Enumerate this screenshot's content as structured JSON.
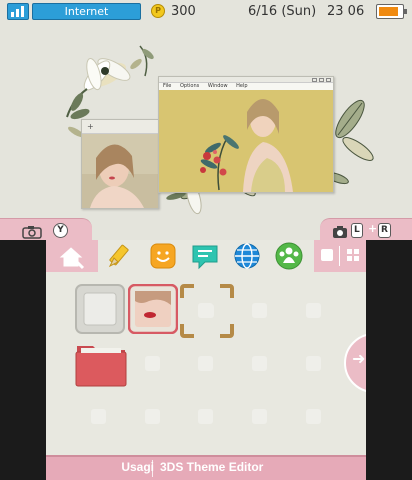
{
  "status_bar": {
    "connection": "Internet",
    "play_coins": "300",
    "date": "6/16 (Sun)",
    "time": "23 06",
    "battery_level": 0.85,
    "coin_glyph": "P"
  },
  "top_screen": {
    "back_window_glyph": "+",
    "front_window_menu": [
      "File",
      "Options",
      "Window",
      "Help"
    ]
  },
  "hinge": {
    "left_button": "Y",
    "right_buttons": [
      "L",
      "R"
    ],
    "right_button_joiner": "+"
  },
  "toolbar": {
    "icons": [
      "home-settings-icon",
      "pencil-icon",
      "smile-icon",
      "chat-bubble-icon",
      "globe-icon",
      "friends-icon",
      "view-toggle-icon"
    ]
  },
  "home_menu": {
    "apps": [
      "empty-slot-app",
      "selected-photo-app",
      "open-folder-app"
    ],
    "scroll_glyph": "➜"
  },
  "footer": {
    "theme_name": "Usagi",
    "product": "3DS Theme Editor"
  },
  "colors": {
    "accent_pink": "#ebbcc6",
    "footer_pink": "#e6aab8",
    "status_blue": "#2c9ed8",
    "wallpaper": "#e4e4dc",
    "folder_red": "#dc5a5e"
  }
}
